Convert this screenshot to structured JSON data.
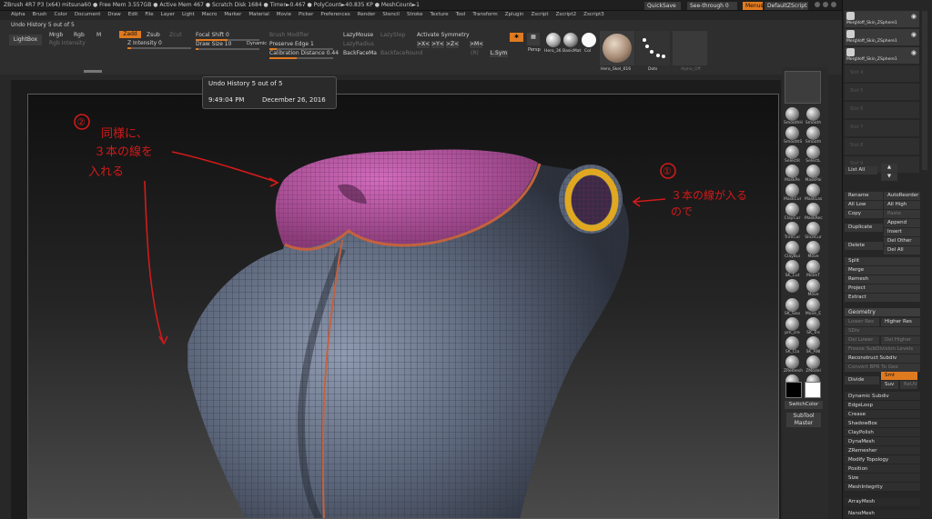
{
  "titlebar": {
    "text": "ZBrush 4R7 P3 (x64)   mitsuna60   ● Free Mem 3.557GB ● Active Mem 467 ● Scratch Disk 1684 ● Timer►0.467 ● PolyCount►40.835 KP ● MeshCount►1",
    "quicksave": "QuickSave",
    "seethrough": "See-through  0",
    "menus": "Menus",
    "defaultzscript": "DefaultZScript"
  },
  "menubar": [
    "Alpha",
    "Brush",
    "Color",
    "Document",
    "Draw",
    "Edit",
    "File",
    "Layer",
    "Light",
    "Macro",
    "Marker",
    "Material",
    "Movie",
    "Picker",
    "Preferences",
    "Render",
    "Stencil",
    "Stroke",
    "Texture",
    "Tool",
    "Transform",
    "Zplugin",
    "Zscript",
    "Zscript2",
    "Zscript3"
  ],
  "toolbar": {
    "undo_history": "Undo History 5 out of 5",
    "lightbox": "LightBox",
    "mrgb": "Mrgb",
    "rgb": "Rgb",
    "m": "M",
    "zadd": "Zadd",
    "zsub": "Zsub",
    "zcut": "Zcut",
    "rgb_intensity": "Rgb Intensity",
    "z_intensity": "Z Intensity 0",
    "focal_shift": "Focal Shift 0",
    "draw_size": "Draw Size 10",
    "dynamic": "Dynamic",
    "brush_modifier": "Brush Modifier",
    "preserve_edge": "Preserve Edge 1",
    "calibration_distance": "Calibration Distance 0.44",
    "lazymouse": "LazyMouse",
    "lazystep": "LazyStep",
    "lazyradius": "LazyRadius",
    "backfacemask": "BackFaceMa",
    "backfacemask_int": "BackfaceInt",
    "backfacemask_round": "BackfaceRound",
    "activate_symmetry": "Activate Symmetry",
    "sym_x": ">X<",
    "sym_y": ">Y<",
    "sym_z": ">Z<",
    "sym_m": ">M<",
    "sym_r": "(R)",
    "sym_l": "L.Sym",
    "sym_count": "(R)",
    "poly": "Poly",
    "persp": "Persp",
    "mat_labels": [
      "Hero_36",
      "BasicMat",
      "Col"
    ],
    "tool_thumbs": [
      "Hero_Skel_016",
      "Dots",
      "Alpha_Off"
    ]
  },
  "tooltip": {
    "title": "Undo History 5 out of 5",
    "time": "9:49:04 PM",
    "date": "December 26, 2016"
  },
  "annotations": {
    "left_number": "②",
    "left_line1": "同様に、",
    "left_line2": "３本の線を",
    "left_line3": "入れる",
    "right_number": "①",
    "right_line1": "３本の線が入る",
    "right_line2": "ので"
  },
  "midtray": {
    "brushes": [
      "SmoothH",
      "Smooth",
      "SmoothS",
      "Smooth",
      "SelectR",
      "SelectL",
      "MaskPe",
      "MaskPai",
      "MaskCur",
      "MaskLas",
      "ClayCur",
      "MaskRec",
      "TrimCur",
      "SliceCur",
      "ClayBui",
      "Move",
      "SK_Cut",
      "MoveT",
      "",
      "Move",
      "SK_Slas",
      "Move_E",
      "pm_cre",
      "SK_Tre",
      "SK_Cla",
      "SK_ANI",
      "ZRemesh",
      "ZModel",
      "SK_Ant",
      "SK_Pen"
    ],
    "switch_color": "SwitchColor",
    "subtool_master": "SubTool Master"
  },
  "right_panel": {
    "subtools": [
      "MergVoff_Skin_ZSphere1",
      "MergVoff_Skin_ZSphere1",
      "MergVoff_Skin_ZSphere1"
    ],
    "empty_slots": [
      "Slot 4",
      "Slot 5",
      "Slot 6",
      "Slot 7",
      "Slot 8",
      "Slot 9"
    ],
    "list_all": "List All",
    "rename": "Rename",
    "autoreorder": "AutoReorder",
    "all_low": "All Low",
    "all_high": "All High",
    "copy": "Copy",
    "paste": "Paste",
    "duplicate": "Duplicate",
    "append": "Append",
    "insert": "Insert",
    "delete": "Delete",
    "del_other": "Del Other",
    "del_all": "Del All",
    "split": "Split",
    "merge": "Merge",
    "remesh": "Remesh",
    "project": "Project",
    "extract": "Extract",
    "geometry": "Geometry",
    "lower_res": "Lower Res",
    "higher_res": "Higher Res",
    "sdiv": "SDiv",
    "del_lower": "Del Lower",
    "del_higher": "Del Higher",
    "freeze_subdiv": "Freeze SubDivision Levels",
    "reconstruct_subdiv": "Reconstruct Subdiv",
    "convert_bpr": "Convert BPR To Geo",
    "divide": "Divide",
    "smt": "Smt",
    "suv": "Suv",
    "reuv": "ReUV",
    "sections": [
      "Dynamic Subdiv",
      "EdgeLoop",
      "Crease",
      "ShadowBox",
      "ClayPolish",
      "DynaMesh",
      "ZRemesher",
      "Modify Topology",
      "Position",
      "Size",
      "MeshIntegrity"
    ],
    "array_mesh": "ArrayMesh",
    "nano_mesh": "NanoMesh"
  },
  "colors": {
    "accent": "#e07a1f",
    "annotation_red": "#d21a1a",
    "mesh_body": "#5a6478",
    "collar": "#b24f9c"
  }
}
